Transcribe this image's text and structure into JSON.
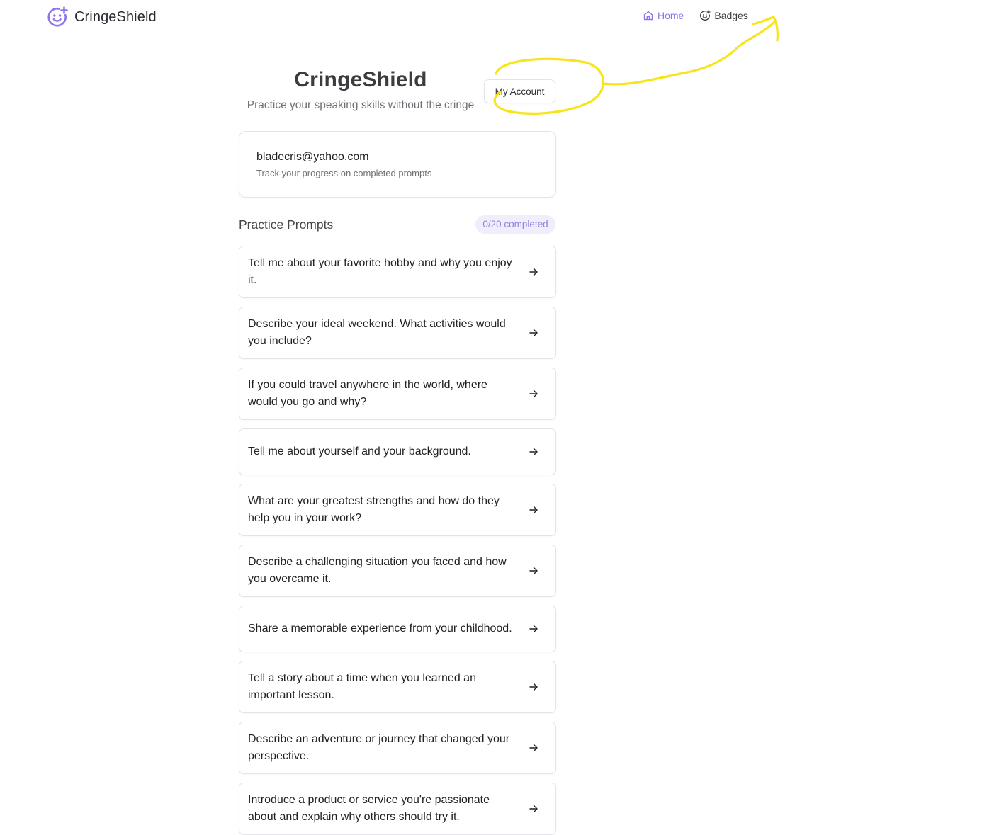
{
  "app": {
    "brand_name": "CringeShield"
  },
  "nav": {
    "items": [
      {
        "label": "Home",
        "icon": "home-icon",
        "active": true
      },
      {
        "label": "Badges",
        "icon": "smile-plus-icon",
        "active": false
      }
    ]
  },
  "header": {
    "title": "CringeShield",
    "subtitle": "Practice your speaking skills without the cringe",
    "account_button": "My Account"
  },
  "user": {
    "email": "bladecris@yahoo.com",
    "note": "Track your progress on completed prompts"
  },
  "prompts": {
    "heading": "Practice Prompts",
    "progress": "0/20 completed",
    "completed": 0,
    "total": 20,
    "items": [
      "Tell me about your favorite hobby and why you enjoy it.",
      "Describe your ideal weekend. What activities would you include?",
      "If you could travel anywhere in the world, where would you go and why?",
      "Tell me about yourself and your background.",
      "What are your greatest strengths and how do they help you in your work?",
      "Describe a challenging situation you faced and how you overcame it.",
      "Share a memorable experience from your childhood.",
      "Tell a story about a time when you learned an important lesson.",
      "Describe an adventure or journey that changed your perspective.",
      "Introduce a product or service you're passionate about and explain why others should try it."
    ]
  },
  "colors": {
    "accent": "#8f74e8",
    "badge_bg": "#f1eefc",
    "badge_text": "#9580e0",
    "annotation": "#f7e51a",
    "border": "#e3e3e8"
  }
}
